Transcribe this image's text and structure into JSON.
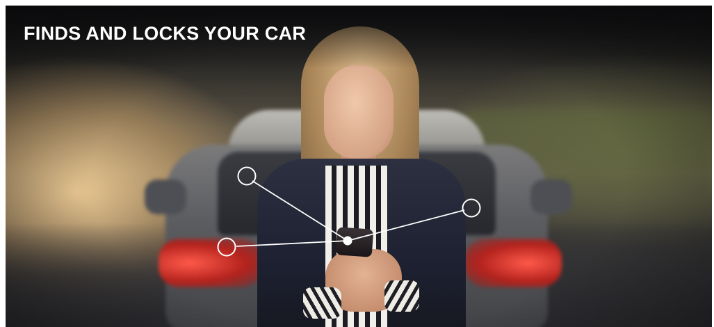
{
  "headline": "FINDS AND LOCKS YOUR CAR",
  "image": {
    "subject": "woman-using-phone-icon",
    "background": "car-rear-icon"
  },
  "graphic": {
    "hub": "connection-hub-icon",
    "nodes": [
      "connection-node-icon",
      "connection-node-icon",
      "connection-node-icon"
    ],
    "line_color": "#ffffff"
  }
}
